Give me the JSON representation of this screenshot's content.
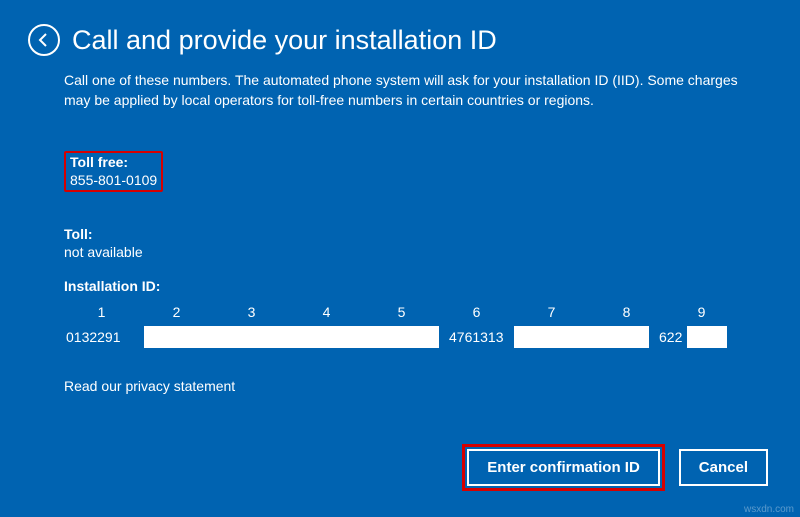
{
  "header": {
    "title": "Call and provide your installation ID"
  },
  "description": "Call one of these numbers. The automated phone system will ask for your installation ID (IID). Some charges may be applied by local operators for toll-free numbers in certain countries or regions.",
  "tollFree": {
    "label": "Toll free:",
    "number": "855-801-0109"
  },
  "toll": {
    "label": "Toll:",
    "value": "not available"
  },
  "installationId": {
    "label": "Installation ID:",
    "columns": [
      "1",
      "2",
      "3",
      "4",
      "5",
      "6",
      "7",
      "8",
      "9"
    ],
    "group1": "0132291",
    "group6": "4761313",
    "group9": "622"
  },
  "links": {
    "privacy": "Read our privacy statement"
  },
  "buttons": {
    "enter": "Enter confirmation ID",
    "cancel": "Cancel"
  },
  "watermark": "wsxdn.com"
}
